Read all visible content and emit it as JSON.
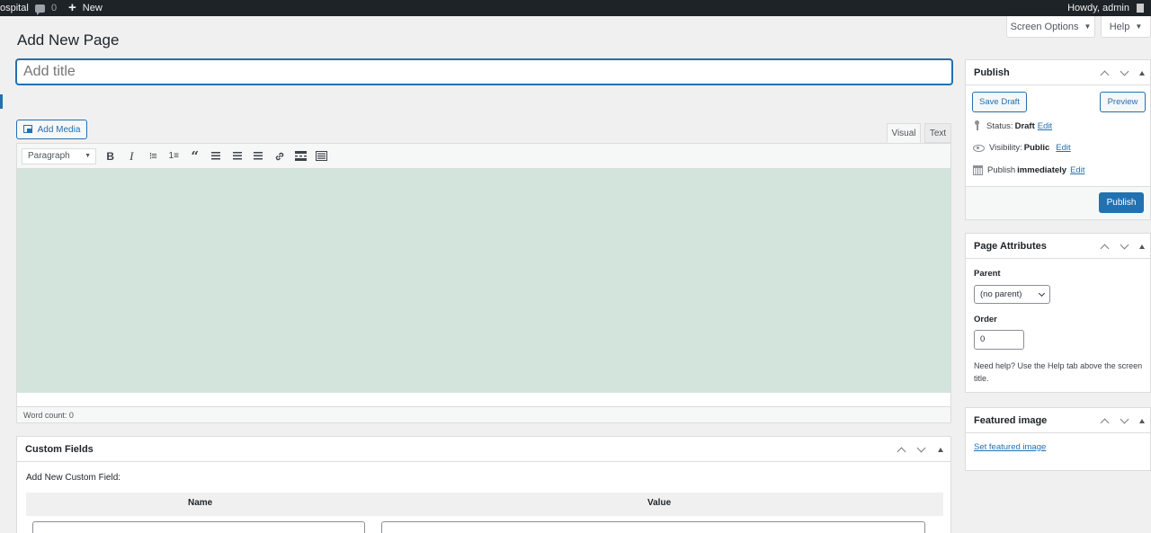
{
  "admin_bar": {
    "site_name": "ospital",
    "comments_count": "0",
    "new_label": "New",
    "howdy": "Howdy, admin"
  },
  "screen_tabs": {
    "screen_options": "Screen Options",
    "help": "Help"
  },
  "page_title": "Add New Page",
  "title_field": {
    "placeholder": "Add title",
    "value": ""
  },
  "editor": {
    "add_media": "Add Media",
    "tabs": {
      "visual": "Visual",
      "text": "Text"
    },
    "format_select": "Paragraph",
    "toolbar_icons": [
      "bold-icon",
      "italic-icon",
      "bulleted-list-icon",
      "numbered-list-icon",
      "blockquote-icon",
      "align-left-icon",
      "align-center-icon",
      "align-right-icon",
      "link-icon",
      "read-more-icon",
      "toolbar-toggle-icon"
    ],
    "word_count": "Word count: 0",
    "canvas_color": "#d2e4dc"
  },
  "custom_fields": {
    "title": "Custom Fields",
    "add_new_label": "Add New Custom Field:",
    "columns": [
      "Name",
      "Value"
    ]
  },
  "publish": {
    "title": "Publish",
    "save_draft": "Save Draft",
    "preview": "Preview",
    "status_label": "Status:",
    "status_value": "Draft",
    "visibility_label": "Visibility:",
    "visibility_value": "Public",
    "publish_label": "Publish",
    "publish_value": "immediately",
    "edit": "Edit",
    "publish_button": "Publish"
  },
  "page_attributes": {
    "title": "Page Attributes",
    "parent_label": "Parent",
    "parent_value": "(no parent)",
    "order_label": "Order",
    "order_value": "0",
    "help_text": "Need help? Use the Help tab above the screen title."
  },
  "featured_image": {
    "title": "Featured image",
    "link": "Set featured image"
  },
  "colors": {
    "admin_bar": "#1d2327",
    "accent": "#2271b1",
    "background": "#f0f0f1"
  }
}
